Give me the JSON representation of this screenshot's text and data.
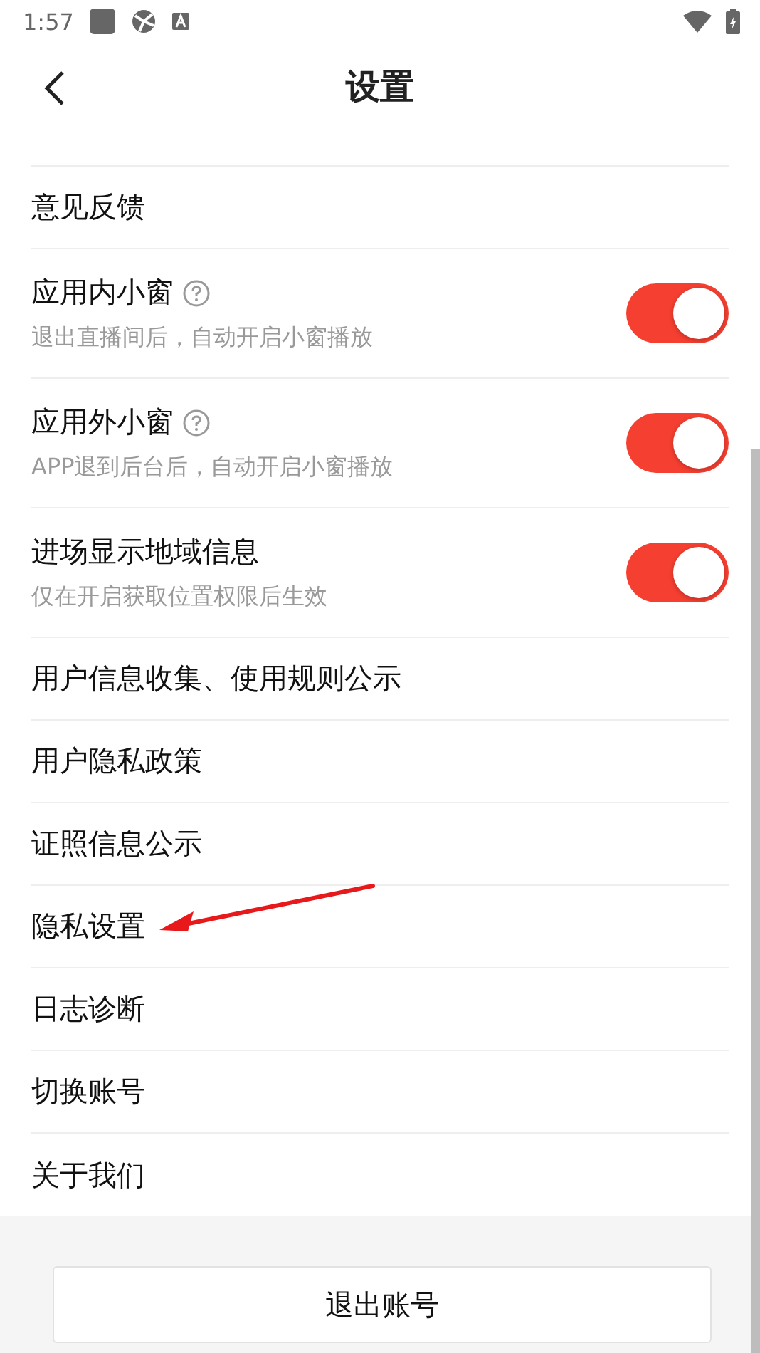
{
  "status_bar": {
    "time": "1:57"
  },
  "header": {
    "title": "设置"
  },
  "items": [
    {
      "kind": "link",
      "label": "意见反馈"
    },
    {
      "kind": "toggle",
      "label": "应用内小窗",
      "help": true,
      "subtitle": "退出直播间后，自动开启小窗播放",
      "on": true
    },
    {
      "kind": "toggle",
      "label": "应用外小窗",
      "help": true,
      "subtitle": "APP退到后台后，自动开启小窗播放",
      "on": true
    },
    {
      "kind": "toggle",
      "label": "进场显示地域信息",
      "subtitle": "仅在开启获取位置权限后生效",
      "on": true
    },
    {
      "kind": "link",
      "label": "用户信息收集、使用规则公示"
    },
    {
      "kind": "link",
      "label": "用户隐私政策"
    },
    {
      "kind": "link",
      "label": "证照信息公示"
    },
    {
      "kind": "link",
      "label": "隐私设置",
      "annotated": true
    },
    {
      "kind": "link",
      "label": "日志诊断"
    },
    {
      "kind": "link",
      "label": "切换账号"
    },
    {
      "kind": "link",
      "label": "关于我们"
    }
  ],
  "logout_button": {
    "label": "退出账号"
  }
}
